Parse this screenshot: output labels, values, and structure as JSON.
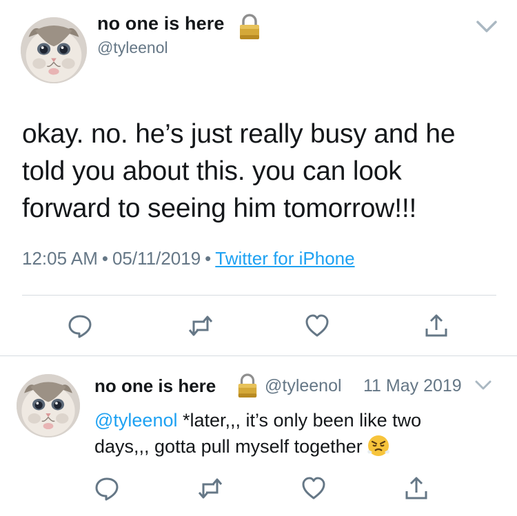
{
  "main_tweet": {
    "display_name": "no one is here",
    "handle": "@tyleenol",
    "text_lines": [
      "okay. no. he’s just really busy and he",
      "told you about this. you can look",
      "forward to seeing him tomorrow!!!"
    ],
    "time": "12:05 AM",
    "date": "05/11/2019",
    "separator": "•",
    "source": "Twitter for iPhone",
    "icons": [
      "avatar",
      "lock-icon",
      "chevron-down-icon",
      "reply-icon",
      "retweet-icon",
      "like-icon",
      "share-icon"
    ]
  },
  "reply_tweet": {
    "display_name": "no one is here",
    "handle": "@tyleenol",
    "date": "11 May 2019",
    "mention": "@tyleenol",
    "text_line1": " *later,,, it’s only been like two",
    "text_line2": "days,,, gotta pull myself together",
    "icons": [
      "avatar",
      "lock-icon",
      "chevron-down-icon",
      "angry-face-emoji",
      "reply-icon",
      "retweet-icon",
      "like-icon",
      "share-icon"
    ]
  },
  "colors": {
    "text": "#14171a",
    "secondary": "#657786",
    "link": "#1da1f2",
    "divider": "#d6dbe0",
    "icon": "#657786"
  }
}
